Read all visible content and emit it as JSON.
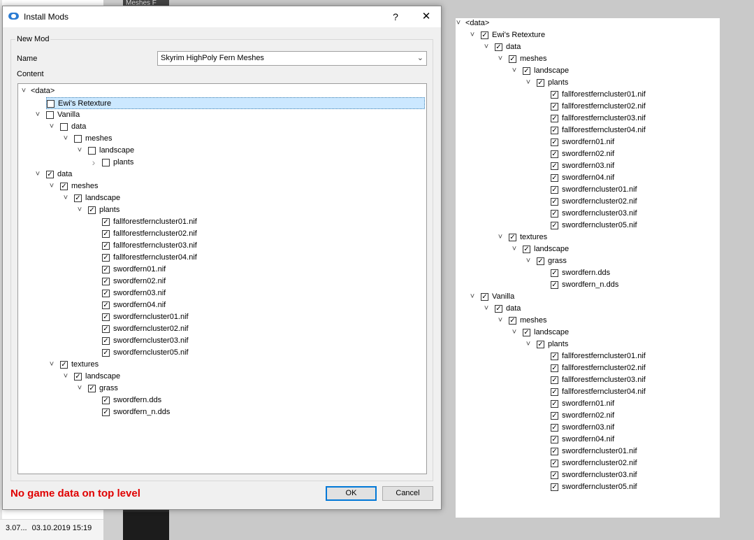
{
  "background": {
    "dark_tab_text": "Meshes F",
    "status": [
      "3.07...",
      "03.10.2019 15:19"
    ]
  },
  "dialog": {
    "title": "Install Mods",
    "help_label": "?",
    "close_label": "✕",
    "group_label": "New Mod",
    "name_label": "Name",
    "name_value": "Skyrim HighPoly Fern Meshes",
    "content_label": "Content",
    "error": "No game data on top level",
    "ok_label": "OK",
    "cancel_label": "Cancel",
    "tree": [
      {
        "d": 0,
        "e": "v",
        "c": null,
        "t": "<data>"
      },
      {
        "d": 1,
        "e": "",
        "c": false,
        "t": "Ewi's Retexture",
        "sel": true
      },
      {
        "d": 1,
        "e": "v",
        "c": false,
        "t": "Vanilla"
      },
      {
        "d": 2,
        "e": "v",
        "c": false,
        "t": "data"
      },
      {
        "d": 3,
        "e": "v",
        "c": false,
        "t": "meshes"
      },
      {
        "d": 4,
        "e": "v",
        "c": false,
        "t": "landscape"
      },
      {
        "d": 5,
        "e": ">",
        "c": false,
        "t": "plants"
      },
      {
        "d": 1,
        "e": "v",
        "c": true,
        "t": "data"
      },
      {
        "d": 2,
        "e": "v",
        "c": true,
        "t": "meshes"
      },
      {
        "d": 3,
        "e": "v",
        "c": true,
        "t": "landscape"
      },
      {
        "d": 4,
        "e": "v",
        "c": true,
        "t": "plants"
      },
      {
        "d": 5,
        "e": "",
        "c": true,
        "t": "fallforestferncluster01.nif"
      },
      {
        "d": 5,
        "e": "",
        "c": true,
        "t": "fallforestferncluster02.nif"
      },
      {
        "d": 5,
        "e": "",
        "c": true,
        "t": "fallforestferncluster03.nif"
      },
      {
        "d": 5,
        "e": "",
        "c": true,
        "t": "fallforestferncluster04.nif"
      },
      {
        "d": 5,
        "e": "",
        "c": true,
        "t": "swordfern01.nif"
      },
      {
        "d": 5,
        "e": "",
        "c": true,
        "t": "swordfern02.nif"
      },
      {
        "d": 5,
        "e": "",
        "c": true,
        "t": "swordfern03.nif"
      },
      {
        "d": 5,
        "e": "",
        "c": true,
        "t": "swordfern04.nif"
      },
      {
        "d": 5,
        "e": "",
        "c": true,
        "t": "swordferncluster01.nif"
      },
      {
        "d": 5,
        "e": "",
        "c": true,
        "t": "swordferncluster02.nif"
      },
      {
        "d": 5,
        "e": "",
        "c": true,
        "t": "swordferncluster03.nif"
      },
      {
        "d": 5,
        "e": "",
        "c": true,
        "t": "swordferncluster05.nif"
      },
      {
        "d": 2,
        "e": "v",
        "c": true,
        "t": "textures"
      },
      {
        "d": 3,
        "e": "v",
        "c": true,
        "t": "landscape"
      },
      {
        "d": 4,
        "e": "v",
        "c": true,
        "t": "grass"
      },
      {
        "d": 5,
        "e": "",
        "c": true,
        "t": "swordfern.dds"
      },
      {
        "d": 5,
        "e": "",
        "c": true,
        "t": "swordfern_n.dds"
      }
    ]
  },
  "right_tree": [
    {
      "d": 0,
      "e": "v",
      "c": null,
      "t": "<data>"
    },
    {
      "d": 1,
      "e": "v",
      "c": true,
      "t": "Ewi's Retexture"
    },
    {
      "d": 2,
      "e": "v",
      "c": true,
      "t": "data"
    },
    {
      "d": 3,
      "e": "v",
      "c": true,
      "t": "meshes"
    },
    {
      "d": 4,
      "e": "v",
      "c": true,
      "t": "landscape"
    },
    {
      "d": 5,
      "e": "v",
      "c": true,
      "t": "plants"
    },
    {
      "d": 6,
      "e": "",
      "c": true,
      "t": "fallforestferncluster01.nif"
    },
    {
      "d": 6,
      "e": "",
      "c": true,
      "t": "fallforestferncluster02.nif"
    },
    {
      "d": 6,
      "e": "",
      "c": true,
      "t": "fallforestferncluster03.nif"
    },
    {
      "d": 6,
      "e": "",
      "c": true,
      "t": "fallforestferncluster04.nif"
    },
    {
      "d": 6,
      "e": "",
      "c": true,
      "t": "swordfern01.nif"
    },
    {
      "d": 6,
      "e": "",
      "c": true,
      "t": "swordfern02.nif"
    },
    {
      "d": 6,
      "e": "",
      "c": true,
      "t": "swordfern03.nif"
    },
    {
      "d": 6,
      "e": "",
      "c": true,
      "t": "swordfern04.nif"
    },
    {
      "d": 6,
      "e": "",
      "c": true,
      "t": "swordferncluster01.nif"
    },
    {
      "d": 6,
      "e": "",
      "c": true,
      "t": "swordferncluster02.nif"
    },
    {
      "d": 6,
      "e": "",
      "c": true,
      "t": "swordferncluster03.nif"
    },
    {
      "d": 6,
      "e": "",
      "c": true,
      "t": "swordferncluster05.nif"
    },
    {
      "d": 3,
      "e": "v",
      "c": true,
      "t": "textures"
    },
    {
      "d": 4,
      "e": "v",
      "c": true,
      "t": "landscape"
    },
    {
      "d": 5,
      "e": "v",
      "c": true,
      "t": "grass"
    },
    {
      "d": 6,
      "e": "",
      "c": true,
      "t": "swordfern.dds"
    },
    {
      "d": 6,
      "e": "",
      "c": true,
      "t": "swordfern_n.dds"
    },
    {
      "d": 1,
      "e": "v",
      "c": true,
      "t": "Vanilla"
    },
    {
      "d": 2,
      "e": "v",
      "c": true,
      "t": "data"
    },
    {
      "d": 3,
      "e": "v",
      "c": true,
      "t": "meshes"
    },
    {
      "d": 4,
      "e": "v",
      "c": true,
      "t": "landscape"
    },
    {
      "d": 5,
      "e": "v",
      "c": true,
      "t": "plants"
    },
    {
      "d": 6,
      "e": "",
      "c": true,
      "t": "fallforestferncluster01.nif"
    },
    {
      "d": 6,
      "e": "",
      "c": true,
      "t": "fallforestferncluster02.nif"
    },
    {
      "d": 6,
      "e": "",
      "c": true,
      "t": "fallforestferncluster03.nif"
    },
    {
      "d": 6,
      "e": "",
      "c": true,
      "t": "fallforestferncluster04.nif"
    },
    {
      "d": 6,
      "e": "",
      "c": true,
      "t": "swordfern01.nif"
    },
    {
      "d": 6,
      "e": "",
      "c": true,
      "t": "swordfern02.nif"
    },
    {
      "d": 6,
      "e": "",
      "c": true,
      "t": "swordfern03.nif"
    },
    {
      "d": 6,
      "e": "",
      "c": true,
      "t": "swordfern04.nif"
    },
    {
      "d": 6,
      "e": "",
      "c": true,
      "t": "swordferncluster01.nif"
    },
    {
      "d": 6,
      "e": "",
      "c": true,
      "t": "swordferncluster02.nif"
    },
    {
      "d": 6,
      "e": "",
      "c": true,
      "t": "swordferncluster03.nif"
    },
    {
      "d": 6,
      "e": "",
      "c": true,
      "t": "swordferncluster05.nif"
    }
  ],
  "colors": {
    "error": "#e00000",
    "selection": "#cce8ff",
    "ok_border": "#0078d7"
  }
}
